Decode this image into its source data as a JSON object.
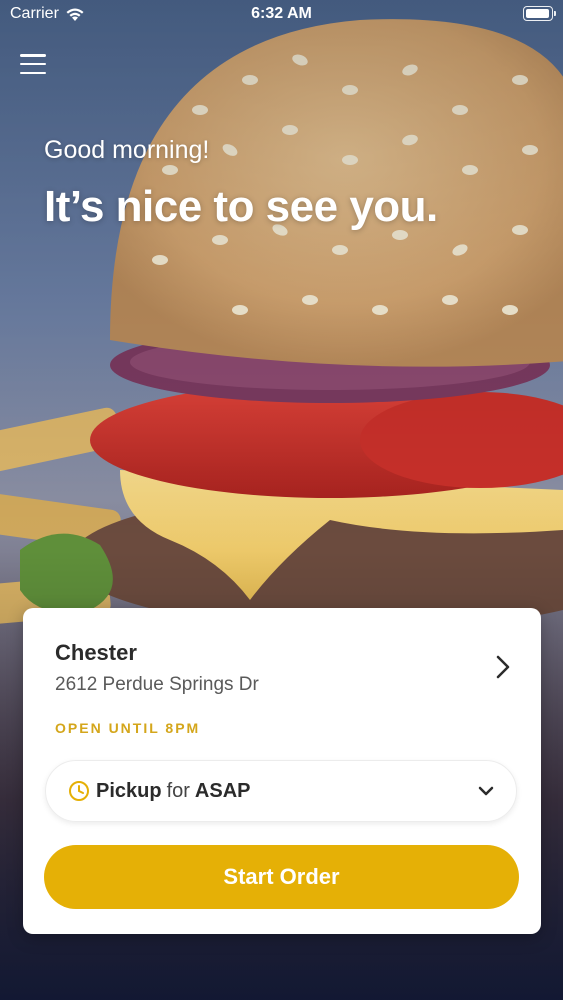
{
  "status_bar": {
    "carrier": "Carrier",
    "time": "6:32 AM",
    "battery_level": 0.95
  },
  "header": {
    "menu_icon": "hamburger-menu-icon"
  },
  "greeting": {
    "salutation": "Good morning!",
    "headline": "It’s nice to see you."
  },
  "store": {
    "name": "Chester",
    "address": "2612 Perdue Springs Dr",
    "hours": "OPEN UNTIL 8PM",
    "hours_color": "#d4a61b"
  },
  "order_options": {
    "mode": "Pickup",
    "connector": "for",
    "time": "ASAP",
    "icon": "clock-icon"
  },
  "actions": {
    "start_order": "Start Order",
    "accent_color": "#e5b006"
  }
}
